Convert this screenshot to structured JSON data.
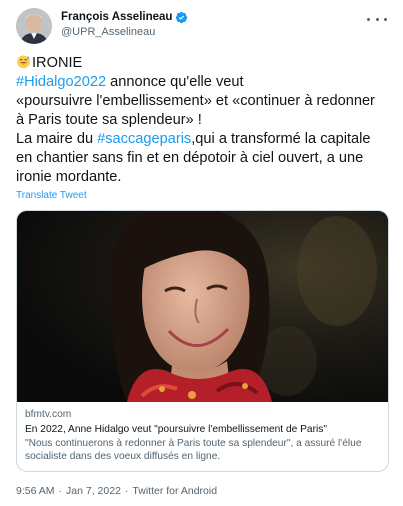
{
  "author": {
    "name": "François Asselineau",
    "handle": "@UPR_Asselineau"
  },
  "tweet": {
    "emoji": "sweat-smile-emoji",
    "line1_text": "IRONIE",
    "line2_hashtag": "#Hidalgo2022",
    "line2_text": " annonce qu'elle veut",
    "line3_text": "«poursuivre l'embellissement» et «continuer à redonner",
    "line4_text": "à Paris toute sa splendeur» !",
    "line5_text_before": "La maire du ",
    "line5_hashtag": "#saccageparis",
    "line5_text_after": ",qui a transformé la capitale",
    "line6_text": "en chantier sans fin et en dépotoir à ciel ouvert, a une",
    "line7_text": "ironie mordante.",
    "translate_label": "Translate Tweet"
  },
  "card": {
    "domain": "bfmtv.com",
    "title": "En 2022, Anne Hidalgo veut \"poursuivre l'embellissement de Paris\"",
    "description": "\"Nous continuerons à redonner à Paris toute sa splendeur\", a assuré l'élue socialiste dans des voeux diffusés en ligne."
  },
  "meta": {
    "time": "9:56 AM",
    "separator1": "·",
    "date": "Jan 7, 2022",
    "separator2": "·",
    "source": "Twitter for Android"
  },
  "colors": {
    "link": "#1d9bf0",
    "secondary_text": "#536471",
    "border": "#cfd9de"
  }
}
